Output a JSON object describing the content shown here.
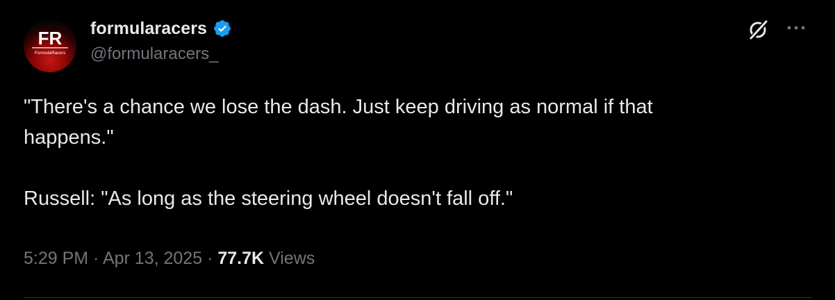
{
  "author": {
    "display_name": "formularacers",
    "handle": "@formularacers_",
    "verified": true,
    "avatar": {
      "monogram": "FR",
      "subtitle": "FormulaRacers",
      "colors": {
        "background": "#050505",
        "glow": "#c41616",
        "text": "#ffffff"
      }
    }
  },
  "icons": {
    "verified": "verified-badge-icon",
    "grok": "grok-icon",
    "more": "more-options-icon"
  },
  "tweet": {
    "lines": [
      "\"There's a chance we lose the dash. Just keep driving as normal if that",
      "happens.\"",
      "",
      "Russell: \"As long as the steering wheel doesn't fall off.\""
    ]
  },
  "meta": {
    "time": "5:29 PM",
    "separator": " · ",
    "date": "Apr 13, 2025",
    "views_count": "77.7K",
    "views_label": "Views"
  },
  "colors": {
    "background": "#000000",
    "primary_text": "#e7e9ea",
    "secondary_text": "#71767b",
    "verified_blue": "#1d9bf0"
  }
}
